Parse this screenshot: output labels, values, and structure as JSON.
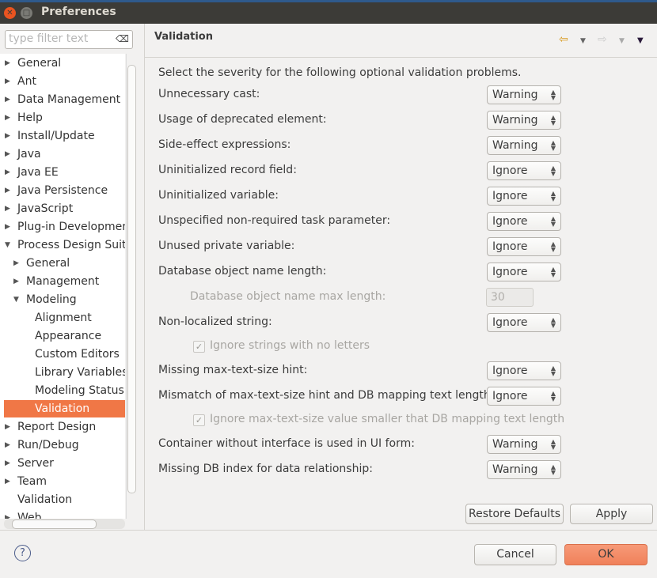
{
  "window": {
    "title": "Preferences"
  },
  "filter": {
    "placeholder": "type filter text"
  },
  "tree": [
    {
      "label": "General",
      "level": 0,
      "expander": "collapsed"
    },
    {
      "label": "Ant",
      "level": 0,
      "expander": "collapsed"
    },
    {
      "label": "Data Management",
      "level": 0,
      "expander": "collapsed"
    },
    {
      "label": "Help",
      "level": 0,
      "expander": "collapsed"
    },
    {
      "label": "Install/Update",
      "level": 0,
      "expander": "collapsed"
    },
    {
      "label": "Java",
      "level": 0,
      "expander": "collapsed"
    },
    {
      "label": "Java EE",
      "level": 0,
      "expander": "collapsed"
    },
    {
      "label": "Java Persistence",
      "level": 0,
      "expander": "collapsed"
    },
    {
      "label": "JavaScript",
      "level": 0,
      "expander": "collapsed"
    },
    {
      "label": "Plug-in Development",
      "level": 0,
      "expander": "collapsed"
    },
    {
      "label": "Process Design Suite",
      "level": 0,
      "expander": "expanded"
    },
    {
      "label": "General",
      "level": 1,
      "expander": "collapsed"
    },
    {
      "label": "Management",
      "level": 1,
      "expander": "collapsed"
    },
    {
      "label": "Modeling",
      "level": 1,
      "expander": "expanded"
    },
    {
      "label": "Alignment",
      "level": 2,
      "expander": "none"
    },
    {
      "label": "Appearance",
      "level": 2,
      "expander": "none"
    },
    {
      "label": "Custom Editors",
      "level": 2,
      "expander": "none"
    },
    {
      "label": "Library Variables",
      "level": 2,
      "expander": "none"
    },
    {
      "label": "Modeling Status",
      "level": 2,
      "expander": "none"
    },
    {
      "label": "Validation",
      "level": 2,
      "expander": "none",
      "selected": true
    },
    {
      "label": "Report Design",
      "level": 0,
      "expander": "collapsed"
    },
    {
      "label": "Run/Debug",
      "level": 0,
      "expander": "collapsed"
    },
    {
      "label": "Server",
      "level": 0,
      "expander": "collapsed"
    },
    {
      "label": "Team",
      "level": 0,
      "expander": "collapsed"
    },
    {
      "label": "Validation",
      "level": 0,
      "expander": "none"
    },
    {
      "label": "Web",
      "level": 0,
      "expander": "collapsed"
    }
  ],
  "page": {
    "title": "Validation",
    "description": "Select the severity for the following optional validation problems.",
    "settings": [
      {
        "type": "combo",
        "label": "Unnecessary cast:",
        "value": "Warning"
      },
      {
        "type": "combo",
        "label": "Usage of deprecated element:",
        "value": "Warning"
      },
      {
        "type": "combo",
        "label": "Side-effect expressions:",
        "value": "Warning"
      },
      {
        "type": "combo",
        "label": "Uninitialized record field:",
        "value": "Ignore"
      },
      {
        "type": "combo",
        "label": "Uninitialized variable:",
        "value": "Ignore"
      },
      {
        "type": "combo",
        "label": "Unspecified non-required task parameter:",
        "value": "Ignore"
      },
      {
        "type": "combo",
        "label": "Unused private variable:",
        "value": "Ignore"
      },
      {
        "type": "combo",
        "label": "Database object name length:",
        "value": "Ignore"
      },
      {
        "type": "number",
        "label": "Database object name max length:",
        "value": "30",
        "disabled": true
      },
      {
        "type": "combo",
        "label": "Non-localized string:",
        "value": "Ignore"
      },
      {
        "type": "checkbox",
        "label": "Ignore strings with no letters",
        "checked": true,
        "disabled": true
      },
      {
        "type": "combo",
        "label": "Missing max-text-size hint:",
        "value": "Ignore"
      },
      {
        "type": "combo",
        "label": "Mismatch of max-text-size hint and DB mapping text length:",
        "value": "Ignore"
      },
      {
        "type": "checkbox",
        "label": "Ignore max-text-size value smaller that DB mapping text length",
        "checked": true,
        "disabled": true
      },
      {
        "type": "combo",
        "label": "Container without interface is used in UI form:",
        "value": "Warning"
      },
      {
        "type": "combo",
        "label": "Missing DB index for data relationship:",
        "value": "Warning"
      }
    ]
  },
  "buttons": {
    "restore": "Restore Defaults",
    "apply": "Apply",
    "cancel": "Cancel",
    "ok": "OK"
  },
  "colors": {
    "selection": "#f07746",
    "ok_button": "#f0815a",
    "titlebar": "#3c3b37"
  }
}
